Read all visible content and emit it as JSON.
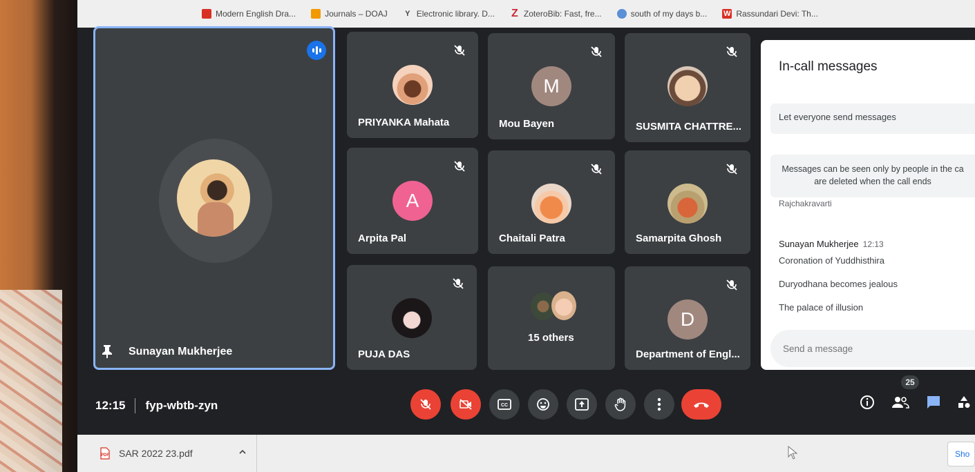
{
  "bookmarks": [
    {
      "label": "Modern English Dra...",
      "icon": "bookmark-icon",
      "color": "#d93025"
    },
    {
      "label": "Journals – DOAJ",
      "icon": "bookmark-icon",
      "color": "#f29900"
    },
    {
      "label": "Electronic library. D...",
      "icon": "bookmark-icon",
      "color": "#4a4a4a"
    },
    {
      "label": "ZoteroBib: Fast, fre...",
      "icon": "zotero-icon",
      "color": "#cc2936"
    },
    {
      "label": "south of my days b...",
      "icon": "globe-icon",
      "color": "#5b8fd6"
    },
    {
      "label": "Rassundari Devi: Th...",
      "icon": "bookmark-icon",
      "color": "#d93025"
    }
  ],
  "main_speaker": {
    "name": "Sunayan Mukherjee"
  },
  "participants": [
    {
      "name": "PRIYANKA Mahata",
      "initial": "",
      "avatar_color": "#c9865e"
    },
    {
      "name": "Mou Bayen",
      "initial": "M",
      "avatar_color": "#a1887f"
    },
    {
      "name": "SUSMITA CHATTRE...",
      "initial": "",
      "avatar_color": "#c9b8a8"
    },
    {
      "name": "Arpita Pal",
      "initial": "A",
      "avatar_color": "#f06292"
    },
    {
      "name": "Chaitali Patra",
      "initial": "",
      "avatar_color": "#e07a52"
    },
    {
      "name": "Samarpita Ghosh",
      "initial": "",
      "avatar_color": "#b98b5f"
    },
    {
      "name": "PUJA DAS",
      "initial": "",
      "avatar_color": "#2a2526"
    },
    {
      "name": "15 others",
      "initial": "",
      "avatar_color": "#6b6b6b"
    },
    {
      "name": "Department of Engl...",
      "initial": "D",
      "avatar_color": "#a1887f"
    }
  ],
  "chat": {
    "title": "In-call messages",
    "toggle_label": "Let everyone send messages",
    "notice": "Messages can be seen only by people in the ca\nare deleted when the call ends",
    "cut_line": "Rajchakravarti",
    "sender": "Sunayan Mukherjee",
    "time": "12:13",
    "messages": [
      "Coronation of Yuddhisthira",
      "Duryodhana becomes jealous",
      "The palace of illusion"
    ],
    "input_placeholder": "Send a message"
  },
  "meeting": {
    "time": "12:15",
    "code": "fyp-wbtb-zyn",
    "people_count": "25"
  },
  "taskbar": {
    "download_file": "SAR 2022 23.pdf",
    "show_all": "Sho"
  },
  "colors": {
    "accent": "#1a73e8",
    "danger": "#ea4335",
    "tile": "#3c4043",
    "background": "#202124"
  }
}
